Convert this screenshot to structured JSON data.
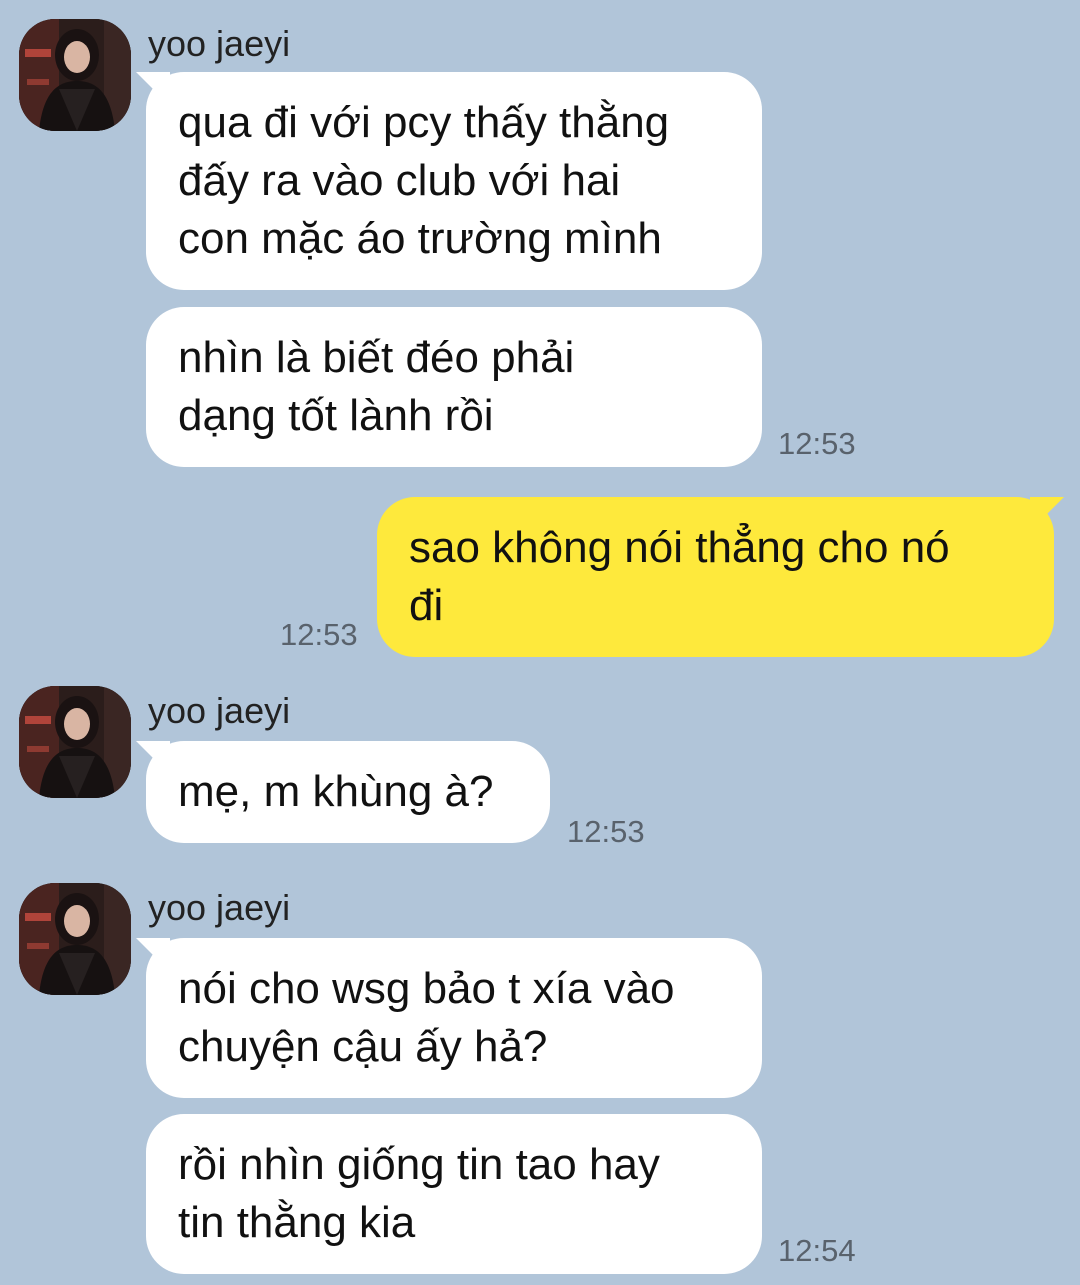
{
  "chat": {
    "contact_name": "yoo jaeyi",
    "groups": [
      {
        "sender": "yoo jaeyi",
        "messages": [
          {
            "text": "qua đi với pcy thấy thằng\nđấy ra vào club với hai\ncon mặc áo trường mình"
          },
          {
            "text": "nhìn là biết đéo phải\ndạng tốt lành rồi",
            "time": "12:53"
          }
        ]
      },
      {
        "sender": "me",
        "messages": [
          {
            "text": "sao không nói thẳng cho nó\nđi",
            "time": "12:53"
          }
        ]
      },
      {
        "sender": "yoo jaeyi",
        "messages": [
          {
            "text": "mẹ, m khùng à?",
            "time": "12:53"
          }
        ]
      },
      {
        "sender": "yoo jaeyi",
        "messages": [
          {
            "text": "nói cho wsg bảo t xía vào\nchuyện cậu ấy hả?"
          },
          {
            "text": "rồi nhìn giống tin tao hay\ntin thằng kia",
            "time": "12:54"
          }
        ]
      }
    ]
  },
  "colors": {
    "background": "#b1c5d9",
    "incoming_bubble": "#ffffff",
    "outgoing_bubble": "#fee93c",
    "timestamp_text": "#59626c"
  }
}
